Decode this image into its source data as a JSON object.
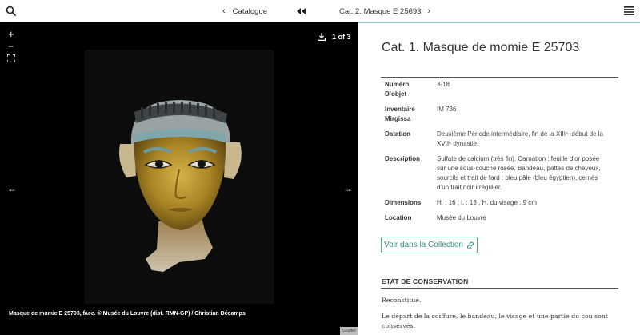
{
  "topbar": {
    "prev_label": "Catalogue",
    "next_label": "Cat. 2. Masque E 25693"
  },
  "viewer": {
    "zoom_in": "+",
    "zoom_out": "−",
    "counter": "1 of 3",
    "caption": "Masque de momie E 25703, face. © Musée du Louvre (dist. RMN-GP) / Christian Décamps",
    "attribution": "Leaflet"
  },
  "entry": {
    "title": "Cat. 1. Masque de momie E 25703",
    "rows": [
      {
        "key1": "Numéro",
        "key2": "D’objet",
        "value1": "3-18",
        "value2": ""
      },
      {
        "key1": "Inventaire",
        "key2": "Mirgissa",
        "value1": "IM 736",
        "value2": ""
      },
      {
        "key1": "Datation",
        "key2": "",
        "value1": "Deuxième Période intermédiaire, fin de la XIIIᵉ–début de la",
        "value2": "XVIIᵉ dynastie."
      },
      {
        "key1": "Description",
        "key2": "",
        "value1": "Sulfate de calcium (très fin). Carnation : feuille d’or posée",
        "value2": "sur une sous-couche rosée. Bandeau, pattes de cheveux,",
        "value3": "sourcils et trait de fard : bleu pâle (bleu égyptien), cernés",
        "value4": "d’un trait noir irrégulier."
      },
      {
        "key1": "Dimensions",
        "key2": "",
        "value1": "H. : 16 ; l. : 13 ; H. du visage : 9 cm",
        "value2": ""
      },
      {
        "key1": "Location",
        "key2": "",
        "value1": "Musée du Louvre",
        "value2": ""
      }
    ],
    "collection_button": "Voir dans la Collection",
    "section_title": "ETAT DE CONSERVATION",
    "paragraphs": [
      "Reconstitué.",
      "Le départ de la coiffure, le bandeau, le visage et une partie du cou sont",
      "conservés."
    ]
  },
  "colors": {
    "accent": "#5aa79a",
    "viewer_bg": "#000000",
    "gold": "#b8942a",
    "blue_band": "#7fa6ab"
  }
}
